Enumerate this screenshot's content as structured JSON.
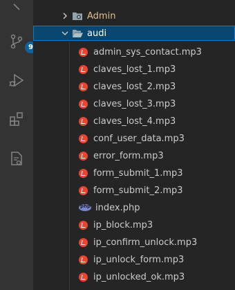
{
  "activity_bar": {
    "source_control_badge": "9"
  },
  "explorer": {
    "folders": [
      {
        "name": "Admin",
        "expanded": false
      },
      {
        "name": "audi",
        "expanded": true
      }
    ],
    "files": [
      {
        "name": "admin_sys_contact.mp3",
        "icon": "audio-icon"
      },
      {
        "name": "claves_lost_1.mp3",
        "icon": "audio-icon"
      },
      {
        "name": "claves_lost_2.mp3",
        "icon": "audio-icon"
      },
      {
        "name": "claves_lost_3.mp3",
        "icon": "audio-icon"
      },
      {
        "name": "claves_lost_4.mp3",
        "icon": "audio-icon"
      },
      {
        "name": "conf_user_data.mp3",
        "icon": "audio-icon"
      },
      {
        "name": "error_form.mp3",
        "icon": "audio-icon"
      },
      {
        "name": "form_submit_1.mp3",
        "icon": "audio-icon"
      },
      {
        "name": "form_submit_2.mp3",
        "icon": "audio-icon"
      },
      {
        "name": "index.php",
        "icon": "php-icon"
      },
      {
        "name": "ip_block.mp3",
        "icon": "audio-icon"
      },
      {
        "name": "ip_confirm_unlock.mp3",
        "icon": "audio-icon"
      },
      {
        "name": "ip_unlock_form.mp3",
        "icon": "audio-icon"
      },
      {
        "name": "ip_unlocked_ok.mp3",
        "icon": "audio-icon"
      }
    ]
  },
  "colors": {
    "activity_bar": "#333333",
    "sidebar": "#252526",
    "selection": "#094771",
    "audio_icon": "#e84533",
    "php_icon": "#7a86d6",
    "badge": "#0e639c"
  }
}
